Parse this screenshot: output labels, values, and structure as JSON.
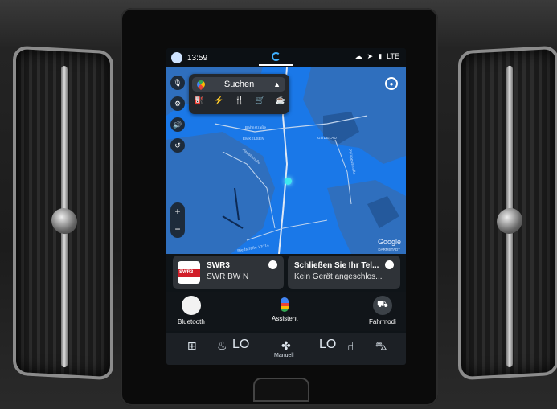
{
  "status_bar": {
    "time": "13:59",
    "indicators": "LTE",
    "icons": [
      "avatar-icon",
      "home-icon",
      "cloud-icon",
      "navigation-icon",
      "signal-icon"
    ]
  },
  "map": {
    "search_label": "Suchen",
    "categories": [
      "gas-station-icon",
      "charging-icon",
      "restaurant-icon",
      "shopping-icon",
      "coffee-icon"
    ],
    "labels": {
      "street1": "Bahnstraße",
      "place1": "EMKELSEN",
      "street2": "Hauptstraße",
      "place2": "GÖDELAU",
      "street3": "Philippsstraße",
      "street4": "Riedstraße L3114"
    },
    "attribution": "Google",
    "attribution_sub": "DARMSTADT",
    "side_buttons": [
      "mic-icon",
      "settings-icon",
      "sound-icon",
      "route-icon"
    ],
    "zoom_in": "+",
    "zoom_out": "−"
  },
  "media": {
    "radio_title": "SWR3",
    "radio_subtitle": "SWR BW N",
    "radio_logo_text": "SWR3",
    "phone_title": "Schließen Sie Ihr Tel...",
    "phone_subtitle": "Kein Gerät angeschlos..."
  },
  "apps": {
    "bluetooth": "Bluetooth",
    "assistant": "Assistent",
    "drive_modes": "Fahrmodi"
  },
  "climate": {
    "left_temp": "LO",
    "right_temp": "LO",
    "fan_label": "Manuell"
  },
  "colors": {
    "map_water": "#1a78e8",
    "map_land": "#2f6fbe",
    "accent": "#3fb0ff"
  }
}
